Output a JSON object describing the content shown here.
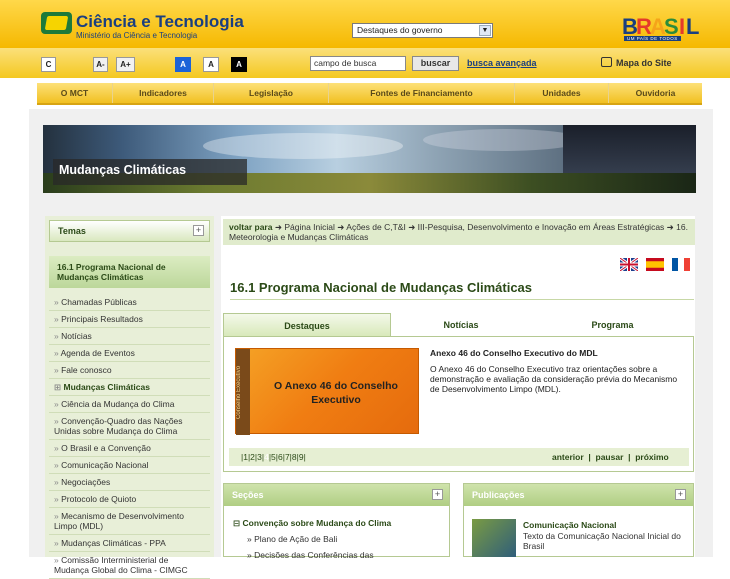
{
  "header": {
    "logo_title": "Ciência e Tecnologia",
    "logo_subtitle": "Ministério da Ciência e Tecnologia",
    "gov_select": "Destaques do governo",
    "brasil_text": "BRASIL",
    "brasil_tagline": "UM PAÍS DE TODOS"
  },
  "toolbar": {
    "font_buttons": [
      "C",
      "A-",
      "A+",
      "A",
      "A",
      "A"
    ],
    "search_value": "campo de busca",
    "search_button": "buscar",
    "advanced_search": "busca avançada",
    "site_map": "Mapa do Site"
  },
  "nav": {
    "items": [
      "O MCT",
      "Indicadores",
      "Legislação",
      "Fontes de Financiamento",
      "Unidades",
      "Ouvidoria"
    ]
  },
  "banner": {
    "title": "Mudanças Climáticas"
  },
  "sidebar": {
    "temas_label": "Temas",
    "section_title": "16.1 Programa Nacional de Mudanças Climáticas",
    "items": [
      {
        "label": "Chamadas Públicas",
        "bold": false
      },
      {
        "label": "Principais Resultados",
        "bold": false
      },
      {
        "label": "Notícias",
        "bold": false
      },
      {
        "label": "Agenda de Eventos",
        "bold": false
      },
      {
        "label": "Fale conosco",
        "bold": false
      },
      {
        "label": "Mudanças Climáticas",
        "bold": true
      },
      {
        "label": "Ciência da Mudança do Clima",
        "bold": false
      },
      {
        "label": "Convenção-Quadro das Nações Unidas sobre Mudança do Clima",
        "bold": false
      },
      {
        "label": "O Brasil e a Convenção",
        "bold": false
      },
      {
        "label": "Comunicação Nacional",
        "bold": false
      },
      {
        "label": "Negociações",
        "bold": false
      },
      {
        "label": "Protocolo de Quioto",
        "bold": false
      },
      {
        "label": "Mecanismo de Desenvolvimento Limpo (MDL)",
        "bold": false
      },
      {
        "label": "Mudanças Climáticas - PPA",
        "bold": false
      },
      {
        "label": "Comissão Interministerial de Mudança Global do Clima - CIMGC",
        "bold": false
      }
    ]
  },
  "breadcrumb": {
    "prefix": "voltar para",
    "items": [
      "Página Inicial",
      "Ações de C,T&I",
      "III-Pesquisa, Desenvolvimento e Inovação em Áreas Estratégicas",
      "16. Meteorologia e Mudanças Climáticas"
    ]
  },
  "page": {
    "title": "16.1 Programa Nacional de Mudanças Climáticas"
  },
  "tabs": [
    "Destaques",
    "Notícias",
    "Programa"
  ],
  "featured": {
    "image_side_label": "Conselho Executivo",
    "image_title": "O Anexo 46 do Conselho Executivo",
    "title": "Anexo 46 do Conselho Executivo do MDL",
    "text": "O Anexo 46 do Conselho Executivo  traz orientações sobre a demonstração e avaliação da consideração prévia do Mecanismo de Desenvolvimento Limpo (MDL)."
  },
  "pager": {
    "pages": [
      "1",
      "2",
      "3",
      "4",
      "5",
      "6",
      "7",
      "8",
      "9"
    ],
    "current": "4",
    "prev": "anterior",
    "pause": "pausar",
    "next": "próximo"
  },
  "sections_box": {
    "title": "Seções",
    "main_item": "Convenção sobre Mudança do Clima",
    "items": [
      "Plano de Ação de Bali",
      "Decisões das Conferências das"
    ]
  },
  "publications_box": {
    "title": "Publicações",
    "item_title": "Comunicação Nacional",
    "item_text": "Texto da Comunicação Nacional Inicial do Brasil"
  },
  "colors": {
    "header_yellow": "#f5b800",
    "dark_green": "#2b4a17",
    "light_green": "#e0ebcc",
    "brand_blue": "#1a3f80"
  }
}
